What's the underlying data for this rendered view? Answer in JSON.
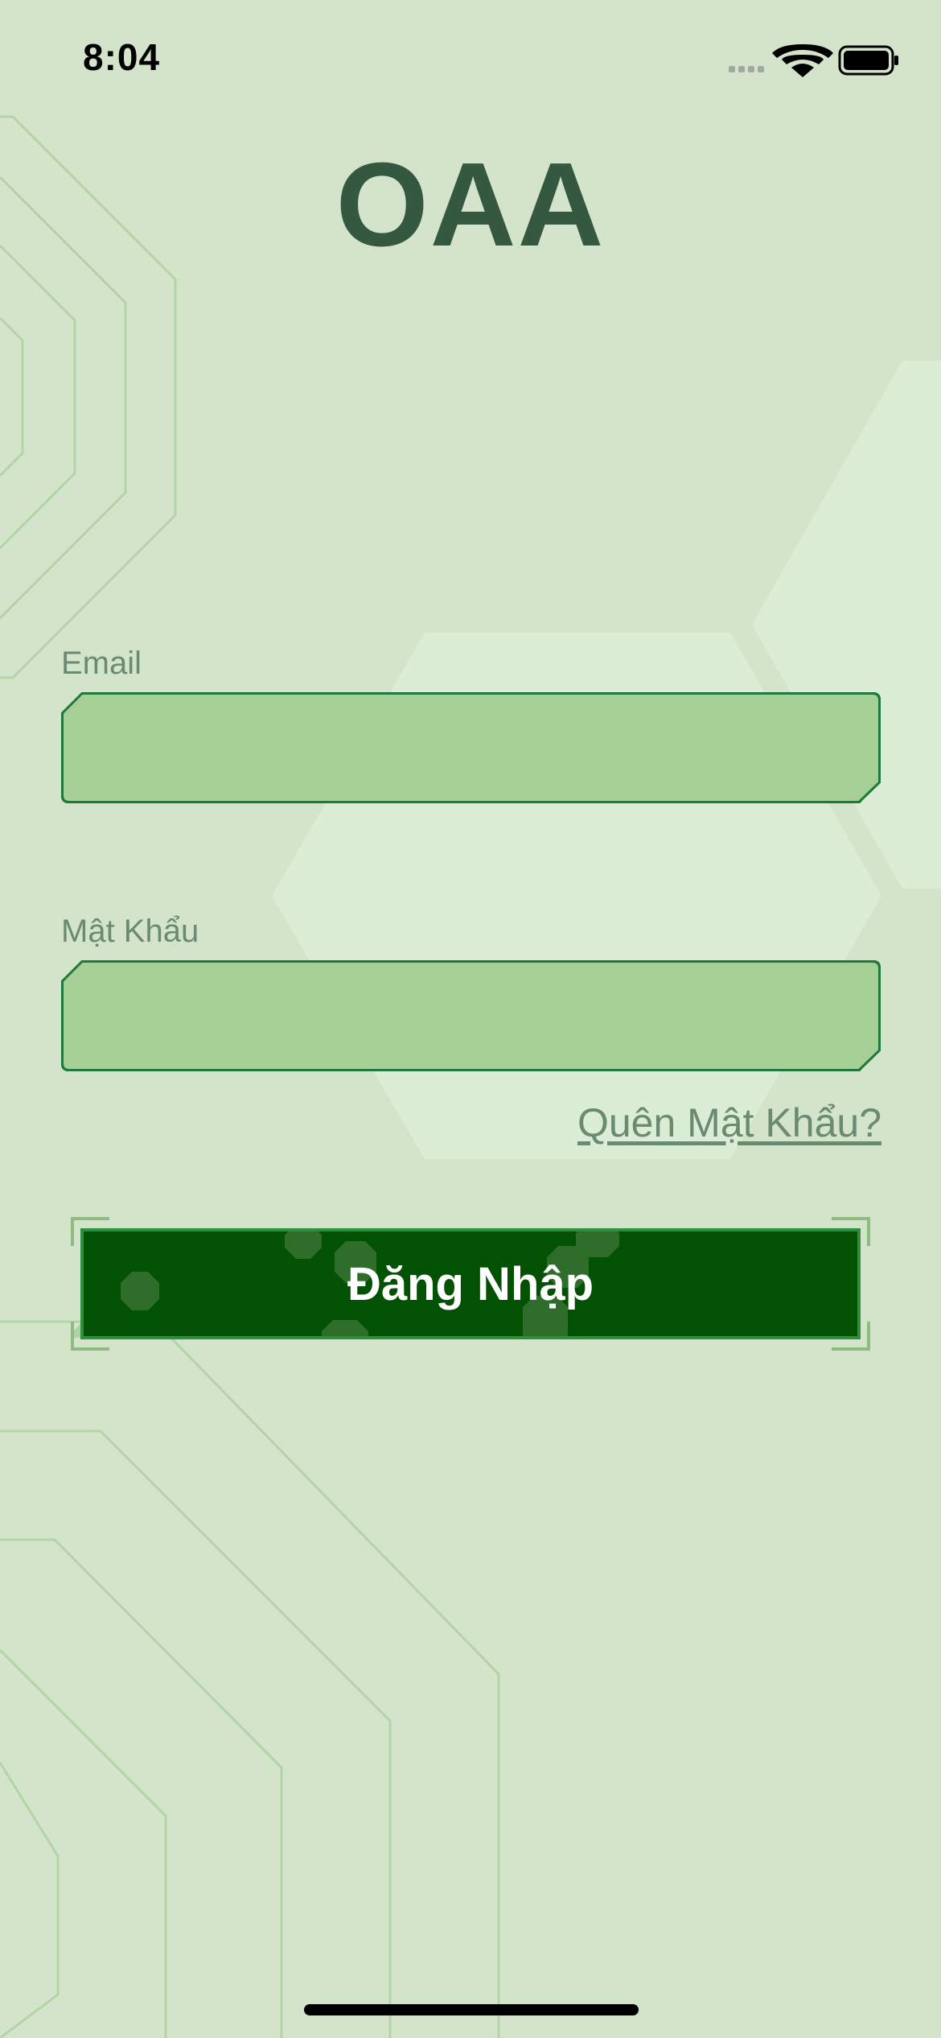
{
  "status_bar": {
    "time": "8:04"
  },
  "app": {
    "title": "OAA"
  },
  "form": {
    "email_label": "Email",
    "email_value": "",
    "password_label": "Mật Khẩu",
    "password_value": "",
    "forgot_password_label": "Quên Mật Khẩu?",
    "login_button_label": "Đăng Nhập"
  },
  "icons": {
    "signal": "cellular-signal-icon",
    "wifi": "wifi-icon",
    "battery": "battery-icon"
  },
  "colors": {
    "background": "#d3e4cb",
    "title": "#345840",
    "input_fill": "#a5cf95",
    "input_border": "#1e7a3c",
    "button": "#035103",
    "label": "#6a8a72"
  }
}
